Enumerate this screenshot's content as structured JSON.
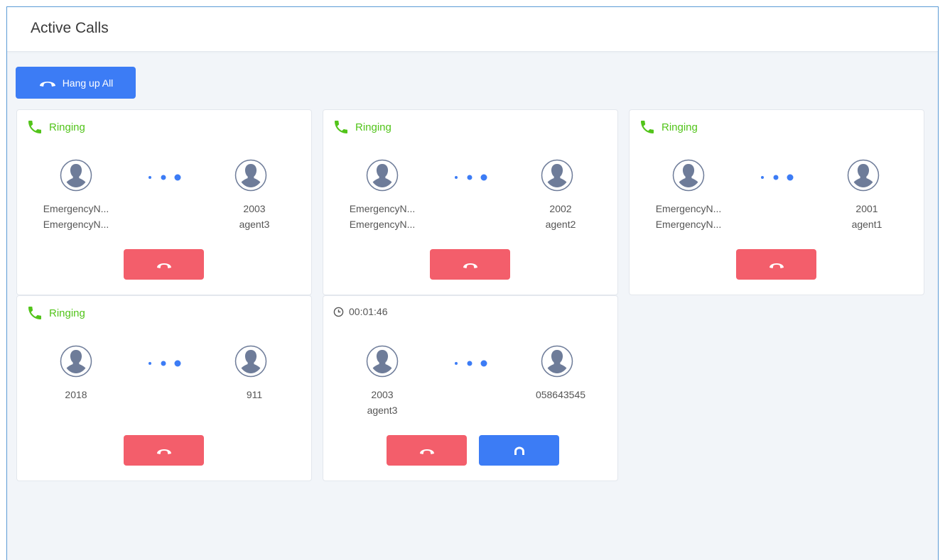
{
  "header": {
    "title": "Active Calls"
  },
  "toolbar": {
    "hangup_all_label": "Hang up All"
  },
  "colors": {
    "accent": "#3c7cf5",
    "danger": "#f35e6b",
    "ringing": "#52c41a"
  },
  "calls": [
    {
      "status": "Ringing",
      "caller": [
        "EmergencyN...",
        "EmergencyN..."
      ],
      "callee": [
        "2003",
        "agent3"
      ]
    },
    {
      "status": "Ringing",
      "caller": [
        "EmergencyN...",
        "EmergencyN..."
      ],
      "callee": [
        "2002",
        "agent2"
      ]
    },
    {
      "status": "Ringing",
      "caller": [
        "EmergencyN...",
        "EmergencyN..."
      ],
      "callee": [
        "2001",
        "agent1"
      ]
    },
    {
      "status": "Ringing",
      "caller": [
        "2018"
      ],
      "callee": [
        "911"
      ]
    },
    {
      "timer": "00:01:46",
      "caller": [
        "2003",
        "agent3"
      ],
      "callee": [
        "058643545"
      ]
    }
  ],
  "icons": {
    "status": "phone-icon",
    "timer": "clock-icon",
    "avatar": "user-avatar-icon",
    "hangup": "hangup-icon",
    "listen": "headset-icon"
  }
}
